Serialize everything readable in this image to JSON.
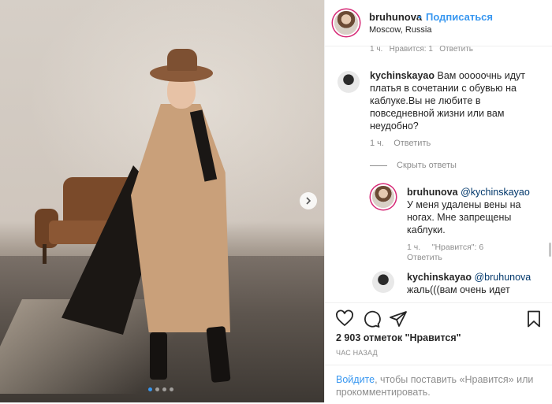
{
  "post": {
    "username": "bruhunova",
    "follow_dot": "•",
    "follow_label": "Подписаться",
    "location": "Moscow, Russia",
    "carousel_dots": 4,
    "carousel_active": 1
  },
  "comments": {
    "top_meta": {
      "time": "1 ч.",
      "likes": "Нравится: 1",
      "reply": "Ответить"
    },
    "c1": {
      "user": "kychinskayao",
      "text": "Вам ооооочнь идут платья в сочетании с обувью на каблуке.Вы не любите в повседневной жизни или вам неудобно?",
      "time": "1 ч.",
      "reply": "Ответить"
    },
    "hide_replies": "Скрыть ответы",
    "r1": {
      "user": "bruhunova",
      "mention": "@kychinskayao",
      "text": "У меня удалены вены на ногах. Мне запрещены каблуки.",
      "time": "1 ч.",
      "likes": "\"Нравится\": 6",
      "reply": "Ответить"
    },
    "r2": {
      "user": "kychinskayao",
      "mention": "@bruhunova",
      "text": "жаль(((вам очень идет"
    }
  },
  "actions": {
    "likes": "2 903 отметок \"Нравится\"",
    "time": "ЧАС НАЗАД",
    "login_link": "Войдите",
    "login_rest": ", чтобы поставить «Нравится» или прокомментировать."
  },
  "icons": [
    "heart-icon",
    "comment-icon",
    "share-icon",
    "bookmark-icon",
    "chevron-right-icon"
  ]
}
